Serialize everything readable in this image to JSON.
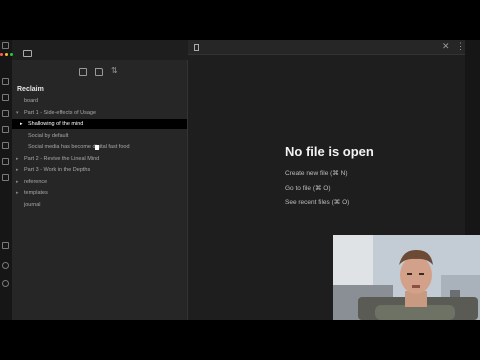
{
  "sidebar": {
    "vault_name": "Reclaim",
    "tree": [
      {
        "label": "board",
        "depth": 0,
        "arrow": ""
      },
      {
        "label": "Part 1 - Side-effects of Usage",
        "depth": 0,
        "arrow": "▾"
      },
      {
        "label": "Shallowing of the mind",
        "depth": 1,
        "arrow": "▸",
        "active": true
      },
      {
        "label": "Social by default",
        "depth": 1,
        "arrow": ""
      },
      {
        "label": "Social media has become digital fast food",
        "depth": 1,
        "arrow": ""
      },
      {
        "label": "Part 2 - Revive the Lineal Mind",
        "depth": 0,
        "arrow": "▸"
      },
      {
        "label": "Part 3 - Work in the Depths",
        "depth": 0,
        "arrow": "▸"
      },
      {
        "label": "reference",
        "depth": 0,
        "arrow": "▸"
      },
      {
        "label": "templates",
        "depth": 0,
        "arrow": "▸"
      },
      {
        "label": "journal",
        "depth": 0,
        "arrow": ""
      }
    ]
  },
  "main": {
    "empty_title": "No file is open",
    "actions": [
      "Create new file (⌘ N)",
      "Go to file (⌘ O)",
      "See recent files (⌘ O)"
    ]
  },
  "icons": {
    "new_note": "new-note-icon",
    "new_folder": "new-folder-icon",
    "sort": "sort-icon",
    "close_tab": "close-icon",
    "more_options": "more-icon"
  },
  "colors": {
    "background": "#1e1e1e",
    "sidebar": "#262626",
    "active_row": "#000000",
    "heading": "#f2f2f2"
  }
}
